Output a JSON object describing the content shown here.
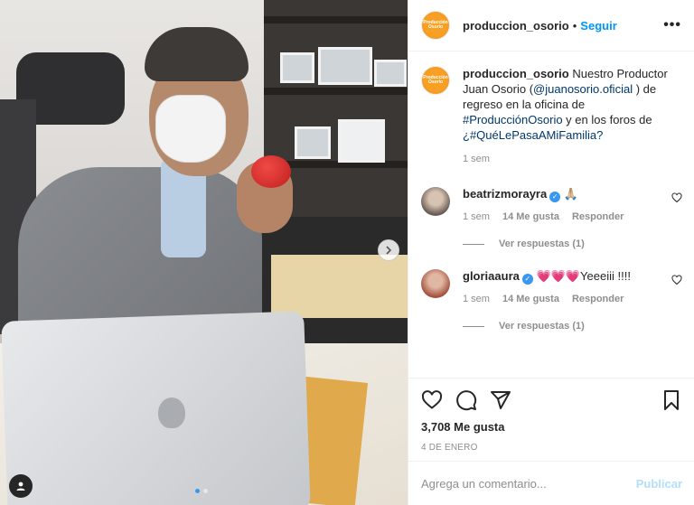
{
  "post": {
    "username": "produccion_osorio",
    "avatar_text": "Producción Osorio",
    "follow_label": "Seguir",
    "separator": "•",
    "more_icon": "ellipsis-icon",
    "caption": {
      "username": "produccion_osorio",
      "text_1": "Nuestro Productor Juan Osorio (",
      "mention": "@juanosorio.oficial",
      "text_2": " ) de regreso en la oficina de ",
      "hashtag_1": "#ProducciónOsorio",
      "text_3": " y en los foros de ",
      "hashtag_2": "¿#QuéLePasaAMiFamilia?",
      "time": "1 sem"
    },
    "comments": [
      {
        "username": "beatrizmorayra",
        "text": "🙏🏼",
        "time": "1 sem",
        "likes": "14 Me gusta",
        "reply_label": "Responder",
        "view_replies": "Ver respuestas (1)",
        "avatar_color": "#6b5d55"
      },
      {
        "username": "gloriaaura",
        "text": "💗💗💗Yeeeiii !!!!",
        "time": "1 sem",
        "likes": "14 Me gusta",
        "reply_label": "Responder",
        "view_replies": "Ver respuestas (1)",
        "avatar_color": "#a5533f"
      }
    ],
    "likes_count": "3,708 Me gusta",
    "date": "4 DE ENERO",
    "comment_placeholder": "Agrega un comentario...",
    "publish_label": "Publicar",
    "colors": {
      "accent": "#0095f6",
      "avatar_orange": "#f7a024",
      "publish_disabled": "#b2dffc"
    },
    "carousel": {
      "slides": 2,
      "active": 1
    }
  }
}
